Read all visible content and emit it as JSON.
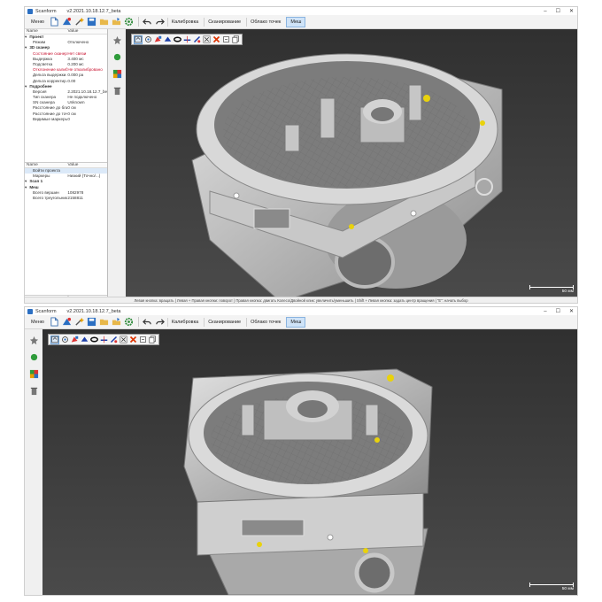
{
  "window": {
    "app_name": "Scanform",
    "version_title": "v2.2021.10.18.12.7_beta",
    "min": "–",
    "max": "☐",
    "close": "✕"
  },
  "toolbar": {
    "menu_label": "Меню",
    "icons": [
      "new-project-icon",
      "scan-icon",
      "wand-icon",
      "save-icon",
      "open-folder-icon",
      "export-icon",
      "settings-gear-icon",
      "undo-icon",
      "redo-icon"
    ],
    "tabs": [
      "Калибровка",
      "Сканирование",
      "Облако точек",
      "Меш"
    ],
    "active_tab": "Меш"
  },
  "panel": {
    "col_name": "Name",
    "col_value": "Value",
    "rows": [
      {
        "k": "Проект",
        "v": "",
        "sec": true,
        "red": false
      },
      {
        "k": "Режим",
        "v": "Отключено",
        "sec": false,
        "red": false
      },
      {
        "k": "3D сканер",
        "v": "",
        "sec": true,
        "red": false
      },
      {
        "k": "Состояние сканера",
        "v": "Нет связи",
        "sec": false,
        "red": true
      },
      {
        "k": "Выдержка",
        "v": "3.400 мс",
        "sec": false,
        "red": false
      },
      {
        "k": "Подсветка",
        "v": "0.200 мс",
        "sec": false,
        "red": false
      },
      {
        "k": "Отклонение калиб...",
        "v": "Не откалибровано",
        "sec": false,
        "red": true
      },
      {
        "k": "Дельта выдержки...",
        "v": "0.000 ра",
        "sec": false,
        "red": false
      },
      {
        "k": "Дельта корректир...",
        "v": "0.00",
        "sec": false,
        "red": false
      },
      {
        "k": "Подробнее",
        "v": "",
        "sec": true,
        "red": false
      },
      {
        "k": "Версия",
        "v": "2.2021.10.18.12.7_beta",
        "sec": false,
        "red": false
      },
      {
        "k": "Тип сканера",
        "v": "Не подключено",
        "sec": false,
        "red": false
      },
      {
        "k": "SN сканера",
        "v": "Unknown",
        "sec": false,
        "red": false
      },
      {
        "k": "Расстояние до ближ...",
        "v": "0 см",
        "sec": false,
        "red": false
      },
      {
        "k": "Расстояние до точки",
        "v": "0 см",
        "sec": false,
        "red": false
      },
      {
        "k": "Видимые маркеры",
        "v": "0",
        "sec": false,
        "red": false
      }
    ],
    "rows2": [
      {
        "k": "Войти проекта",
        "v": "",
        "sec": false,
        "red": false,
        "sel": true
      },
      {
        "k": "Маркеры",
        "v": "Низкий (Точно/...)",
        "sec": false,
        "red": false,
        "sel": false
      },
      {
        "k": "Scan 1",
        "v": "",
        "sec": true,
        "red": false,
        "sel": false
      },
      {
        "k": "Меш",
        "v": "",
        "sec": true,
        "red": false,
        "sel": false
      },
      {
        "k": "Всего вершин",
        "v": "1082978",
        "sec": false,
        "red": false,
        "sel": false
      },
      {
        "k": "Всего треугольников",
        "v": "2158811",
        "sec": false,
        "red": false,
        "sel": false
      }
    ],
    "tab_project": "Проект",
    "tab_settings": "Настройки"
  },
  "side_icons": [
    "star-icon",
    "green-dot-icon",
    "multicolor-cube-icon",
    "trash-icon"
  ],
  "view_tools": [
    "fit-view-icon",
    "target-rotate-icon",
    "select-red-icon",
    "fill-blue-icon",
    "ring-icon",
    "plane-cut-icon",
    "align-icon",
    "remove-markers-icon",
    "delete-red-x-icon",
    "export-mesh-icon",
    "copy-icon"
  ],
  "scale_label": "50 мм",
  "status_text": "Левая кнопка: вращать   |   Левая + Правая кнопки: поворот   |   Правая кнопка: двигать   Колесо/Двойной клик: увеличить/уменьшить   |   Shift + Левая кнопка: задать центр вращения   |   \"E\": начать выбор",
  "colors": {
    "viewport_bg": "#3a3a3a",
    "model_grey": "#b9b9b9",
    "marker_yellow": "#e9d20c",
    "error_red": "#c8102e",
    "active_tab": "#cfe3f7"
  }
}
